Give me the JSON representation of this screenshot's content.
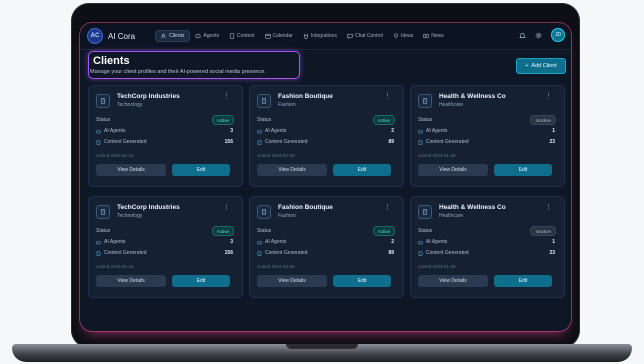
{
  "app": {
    "badge": "AC",
    "name": "AI Cora"
  },
  "nav": [
    {
      "label": "Clients",
      "icon": "users-icon",
      "active": true
    },
    {
      "label": "Agents",
      "icon": "bot-icon"
    },
    {
      "label": "Content",
      "icon": "file-icon"
    },
    {
      "label": "Calendar",
      "icon": "calendar-icon"
    },
    {
      "label": "Integrations",
      "icon": "plug-icon"
    },
    {
      "label": "Chat Control",
      "icon": "chat-icon"
    },
    {
      "label": "Ideas",
      "icon": "lightbulb-icon"
    },
    {
      "label": "News",
      "icon": "newspaper-icon"
    }
  ],
  "user": {
    "initials": "JD"
  },
  "header": {
    "title": "Clients",
    "subtitle": "Manage your client profiles and their AI-powered social media presence.",
    "add_button": "Add Client"
  },
  "labels": {
    "status": "Status",
    "ai_agents": "AI Agents",
    "content_generated": "Content Generated",
    "view_details": "View Details",
    "edit": "Edit"
  },
  "cards": [
    {
      "name": "TechCorp Industries",
      "industry": "Technology",
      "status": "Active",
      "status_type": "active",
      "ai_agents": "3",
      "content": "156",
      "joined": "Joined 2024-01-15"
    },
    {
      "name": "Fashion Boutique",
      "industry": "Fashion",
      "status": "Active",
      "status_type": "active",
      "ai_agents": "2",
      "content": "89",
      "joined": "Joined 2024-02-03"
    },
    {
      "name": "Health & Wellness Co",
      "industry": "Healthcare",
      "status": "Inactive",
      "status_type": "inactive",
      "ai_agents": "1",
      "content": "23",
      "joined": "Joined 2024-01-28"
    },
    {
      "name": "TechCorp Industries",
      "industry": "Technology",
      "status": "Active",
      "status_type": "active",
      "ai_agents": "3",
      "content": "156",
      "joined": "Joined 2024-01-15"
    },
    {
      "name": "Fashion Boutique",
      "industry": "Fashion",
      "status": "Active",
      "status_type": "active",
      "ai_agents": "2",
      "content": "89",
      "joined": "Joined 2024-02-03"
    },
    {
      "name": "Health & Wellness Co",
      "industry": "Healthcare",
      "status": "Inactive",
      "status_type": "inactive",
      "ai_agents": "1",
      "content": "23",
      "joined": "Joined 2024-01-28"
    }
  ]
}
